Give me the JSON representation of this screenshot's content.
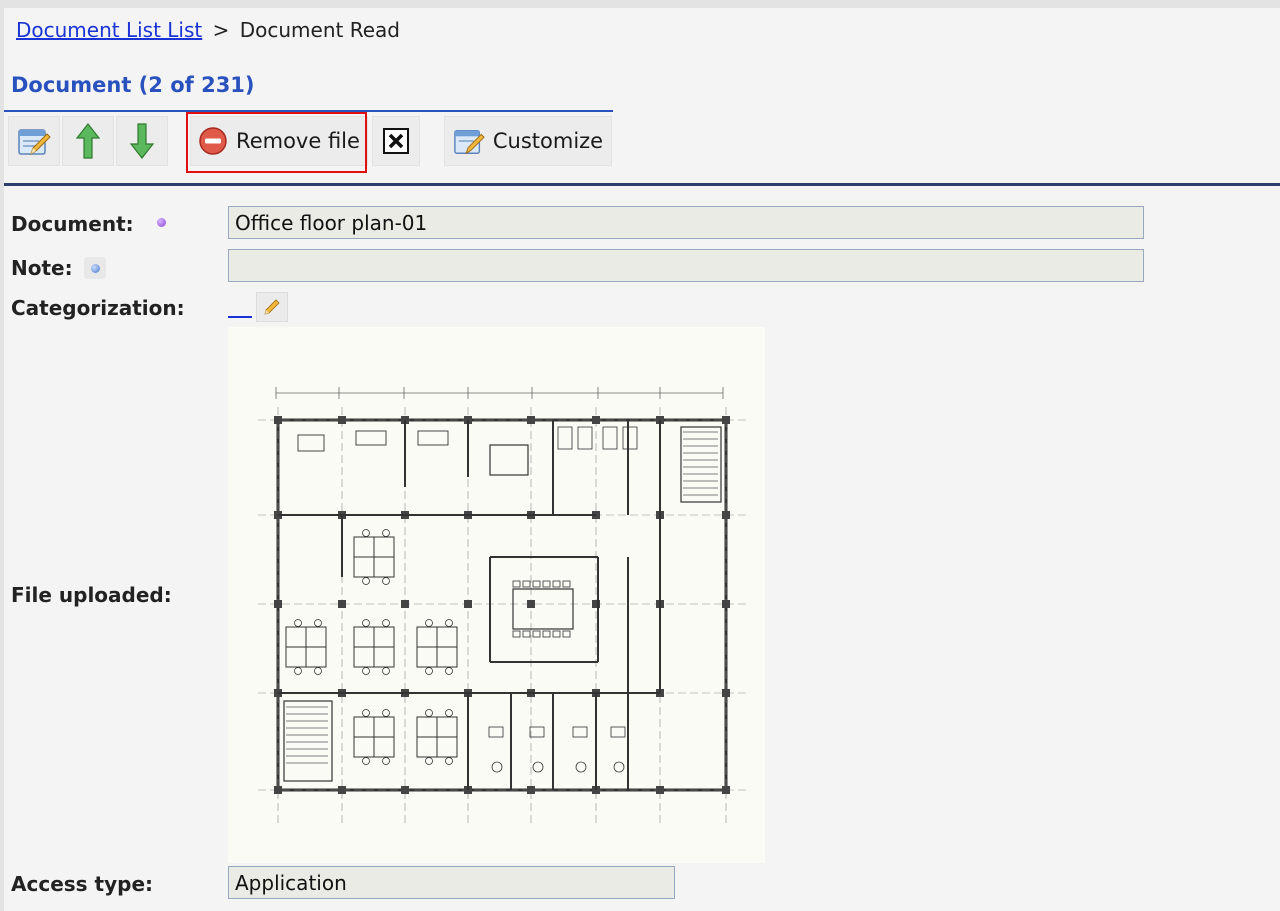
{
  "breadcrumb": {
    "link": "Document List List",
    "separator": ">",
    "current": "Document Read"
  },
  "document_header": {
    "title": "Document (2 of 231)"
  },
  "toolbar": {
    "remove_file_label": "Remove file",
    "customize_label": "Customize"
  },
  "form": {
    "document_label": "Document:",
    "document_value": "Office floor plan-01",
    "note_label": "Note:",
    "note_value": "",
    "categorization_label": "Categorization:",
    "file_label": "File uploaded:",
    "access_label": "Access type:",
    "access_value": "Application"
  },
  "colors": {
    "link": "#1a33d6",
    "title": "#2a52be",
    "highlight": "#e01010",
    "rule": "#2c3e6b"
  },
  "icons": [
    "edit-icon",
    "arrow-up-icon",
    "arrow-down-icon",
    "remove-circle-icon",
    "close-x-icon",
    "customize-icon",
    "required-dot-icon",
    "info-icon",
    "pencil-icon"
  ]
}
